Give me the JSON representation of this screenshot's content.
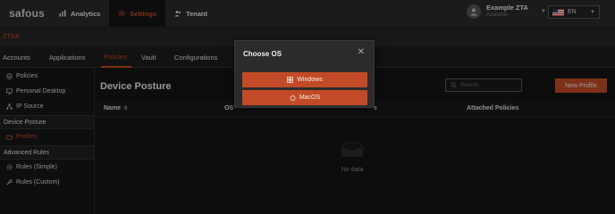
{
  "app": {
    "logo_text": "safous"
  },
  "topnav": [
    {
      "label": "Analytics",
      "icon": "bar-chart-icon"
    },
    {
      "label": "Settings",
      "icon": "gear-icon"
    },
    {
      "label": "Tenant",
      "icon": "users-icon"
    }
  ],
  "user": {
    "name": "Example ZTA",
    "status": "Available"
  },
  "language": {
    "selected": "EN"
  },
  "context": {
    "label": "ZTNA"
  },
  "tabs": [
    "Accounts",
    "Applications",
    "Policies",
    "Vault",
    "Configurations"
  ],
  "sidebar": {
    "items": [
      {
        "label": "Policies",
        "icon": "check-circle-icon"
      },
      {
        "label": "Personal Desktop",
        "icon": "monitor-icon"
      },
      {
        "label": "IP Source",
        "icon": "network-icon"
      }
    ],
    "device_posture_header": "Device Posture",
    "device_posture_items": [
      {
        "label": "Profiles",
        "icon": "folder-icon"
      }
    ],
    "advanced_header": "Advanced Rules",
    "advanced_items": [
      {
        "label": "Rules (Simple)",
        "icon": "gear-icon"
      },
      {
        "label": "Rules (Custom)",
        "icon": "wrench-icon"
      }
    ]
  },
  "main": {
    "title": "Device Posture",
    "search_placeholder": "Search",
    "new_button": "New Profile",
    "columns": [
      "Name",
      "OS",
      "s",
      "Attached Policies"
    ],
    "empty_text": "No data"
  },
  "modal": {
    "title": "Choose OS",
    "options": [
      {
        "label": "Windows",
        "icon": "windows-icon"
      },
      {
        "label": "MacOS",
        "icon": "apple-icon"
      }
    ]
  },
  "colors": {
    "accent": "#c24a26",
    "background": "#141414",
    "topbar": "#2a2a2a"
  }
}
